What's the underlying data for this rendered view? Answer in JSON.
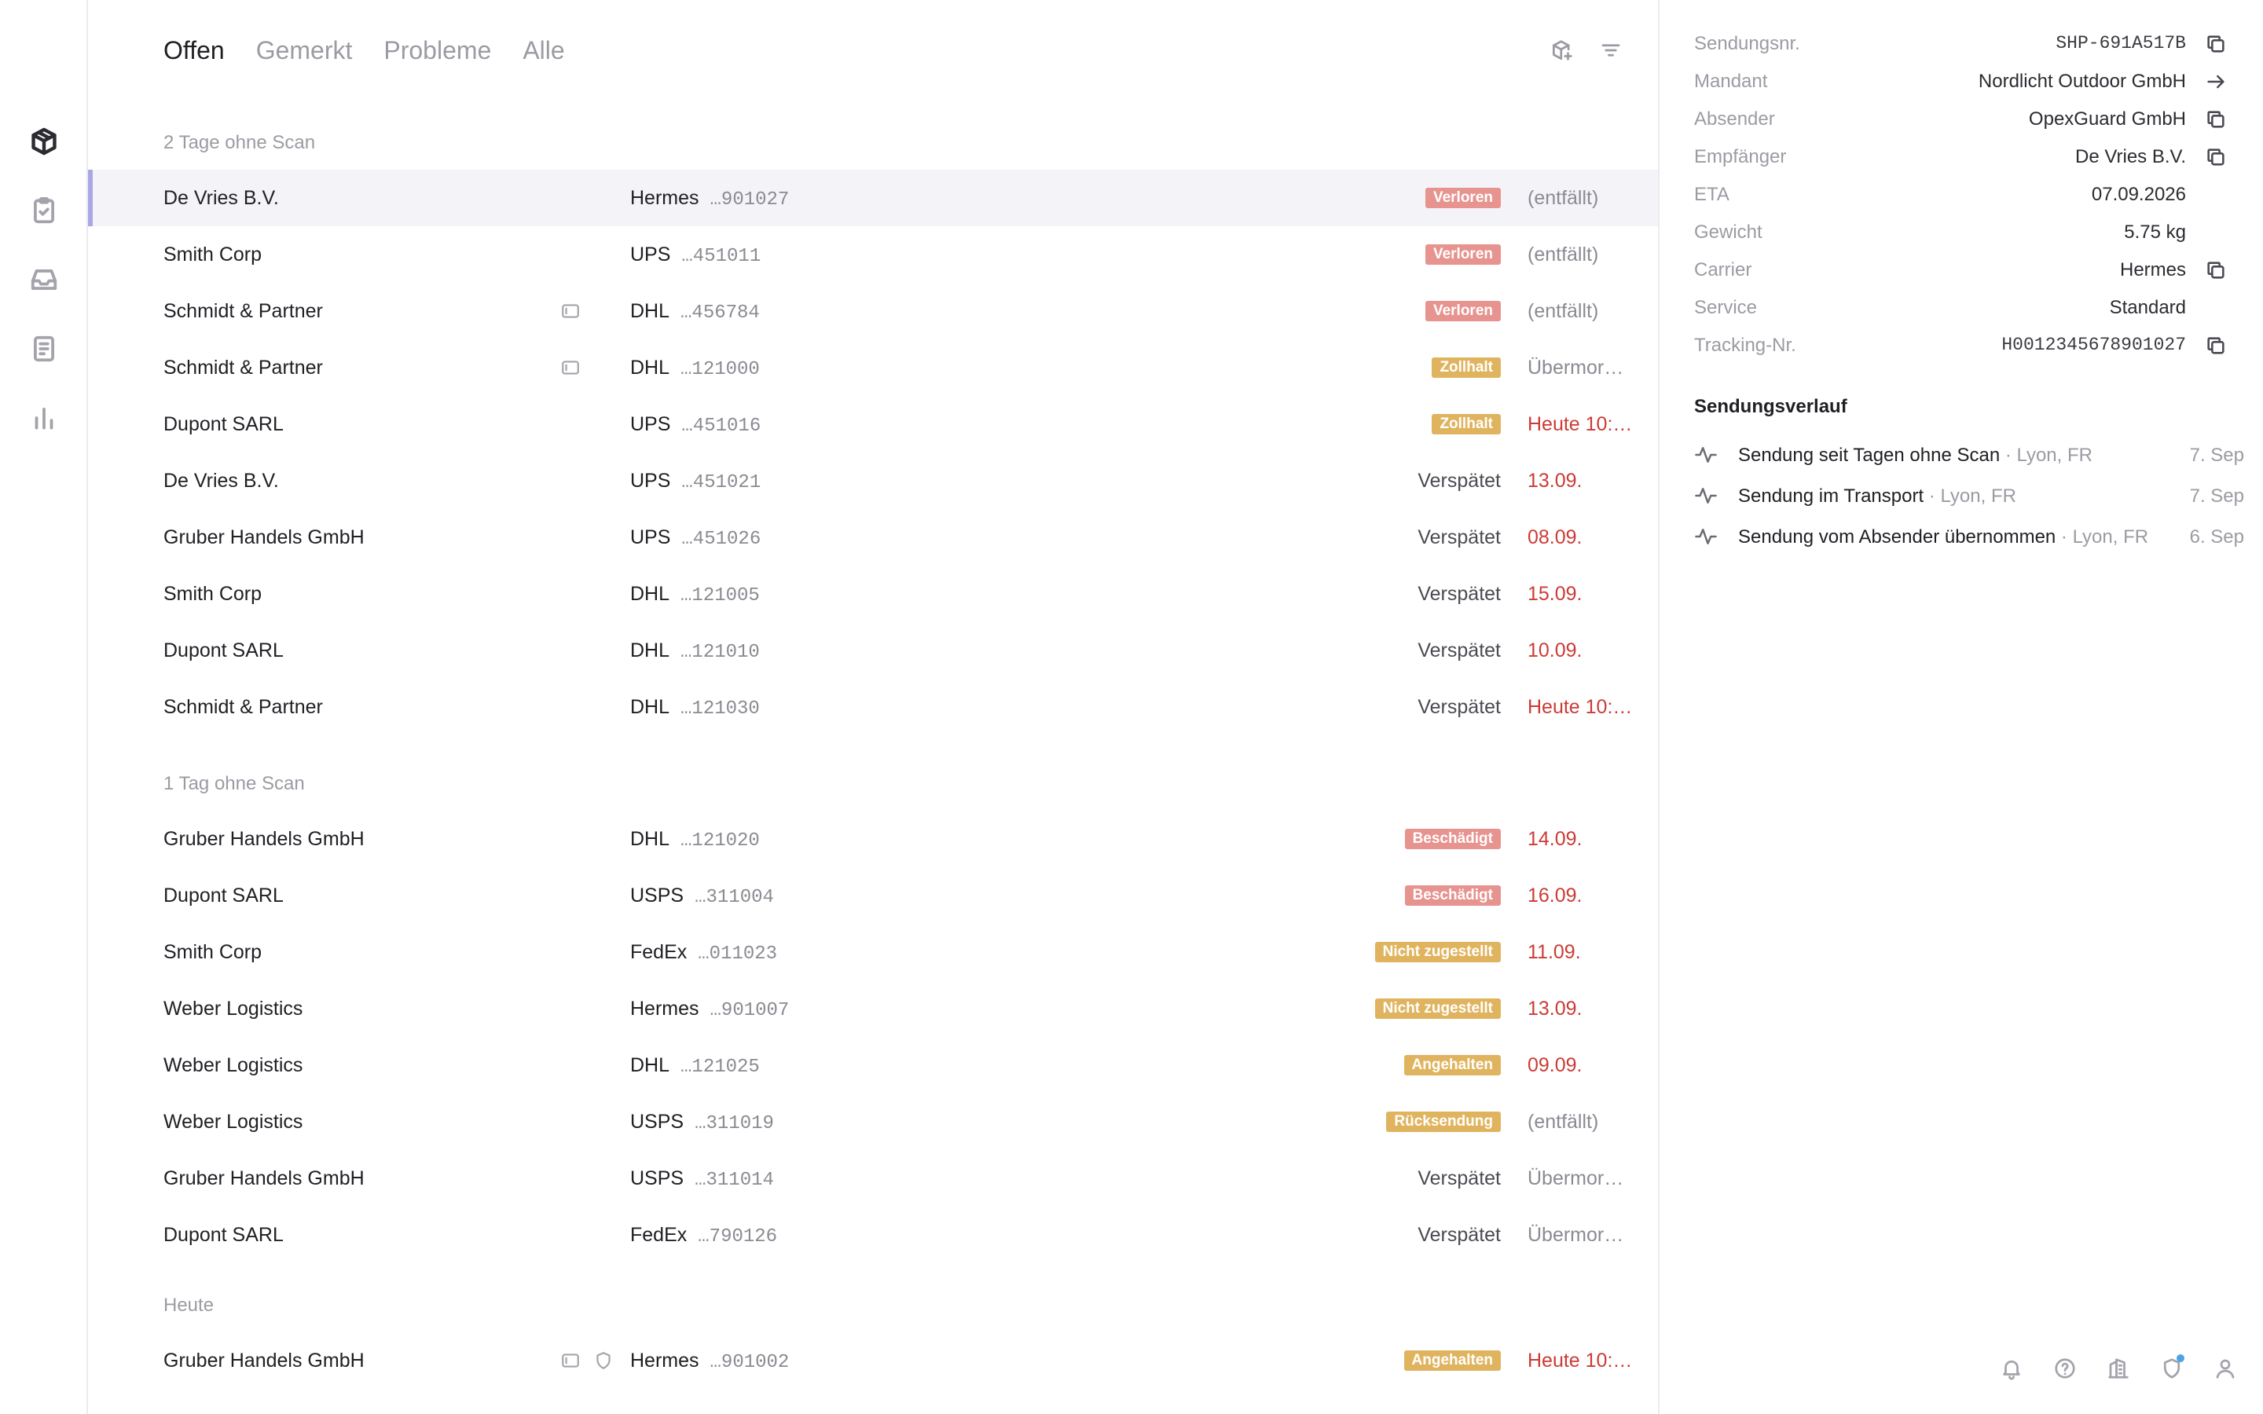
{
  "tabs": [
    {
      "label": "Offen",
      "active": true
    },
    {
      "label": "Gemerkt",
      "active": false
    },
    {
      "label": "Probleme",
      "active": false
    },
    {
      "label": "Alle",
      "active": false
    }
  ],
  "groups": [
    {
      "header": "2 Tage ohne Scan",
      "rows": [
        {
          "name": "De Vries B.V.",
          "carrier": "Hermes",
          "tracking": "…901027",
          "status": "Verloren",
          "status_kind": "badge-red",
          "date": "(entfällt)",
          "date_kind": "muted",
          "selected": true,
          "icons": []
        },
        {
          "name": "Smith Corp",
          "carrier": "UPS",
          "tracking": "…451011",
          "status": "Verloren",
          "status_kind": "badge-red",
          "date": "(entfällt)",
          "date_kind": "muted",
          "icons": []
        },
        {
          "name": "Schmidt & Partner",
          "carrier": "DHL",
          "tracking": "…456784",
          "status": "Verloren",
          "status_kind": "badge-red",
          "date": "(entfällt)",
          "date_kind": "muted",
          "icons": [
            "card-icon"
          ]
        },
        {
          "name": "Schmidt & Partner",
          "carrier": "DHL",
          "tracking": "…121000",
          "status": "Zollhalt",
          "status_kind": "badge-amber",
          "date": "Übermor…",
          "date_kind": "muted",
          "icons": [
            "card-icon"
          ]
        },
        {
          "name": "Dupont SARL",
          "carrier": "UPS",
          "tracking": "…451016",
          "status": "Zollhalt",
          "status_kind": "badge-amber",
          "date": "Heute 10:…",
          "date_kind": "red",
          "icons": []
        },
        {
          "name": "De Vries B.V.",
          "carrier": "UPS",
          "tracking": "…451021",
          "status": "Verspätet",
          "status_kind": "text",
          "date": "13.09.",
          "date_kind": "red",
          "icons": []
        },
        {
          "name": "Gruber Handels GmbH",
          "carrier": "UPS",
          "tracking": "…451026",
          "status": "Verspätet",
          "status_kind": "text",
          "date": "08.09.",
          "date_kind": "red",
          "icons": []
        },
        {
          "name": "Smith Corp",
          "carrier": "DHL",
          "tracking": "…121005",
          "status": "Verspätet",
          "status_kind": "text",
          "date": "15.09.",
          "date_kind": "red",
          "icons": []
        },
        {
          "name": "Dupont SARL",
          "carrier": "DHL",
          "tracking": "…121010",
          "status": "Verspätet",
          "status_kind": "text",
          "date": "10.09.",
          "date_kind": "red",
          "icons": []
        },
        {
          "name": "Schmidt & Partner",
          "carrier": "DHL",
          "tracking": "…121030",
          "status": "Verspätet",
          "status_kind": "text",
          "date": "Heute 10:…",
          "date_kind": "red",
          "icons": []
        }
      ]
    },
    {
      "header": "1 Tag ohne Scan",
      "rows": [
        {
          "name": "Gruber Handels GmbH",
          "carrier": "DHL",
          "tracking": "…121020",
          "status": "Beschädigt",
          "status_kind": "badge-red",
          "date": "14.09.",
          "date_kind": "red",
          "icons": []
        },
        {
          "name": "Dupont SARL",
          "carrier": "USPS",
          "tracking": "…311004",
          "status": "Beschädigt",
          "status_kind": "badge-red",
          "date": "16.09.",
          "date_kind": "red",
          "icons": []
        },
        {
          "name": "Smith Corp",
          "carrier": "FedEx",
          "tracking": "…011023",
          "status": "Nicht zugestellt",
          "status_kind": "badge-amber",
          "date": "11.09.",
          "date_kind": "red",
          "icons": []
        },
        {
          "name": "Weber Logistics",
          "carrier": "Hermes",
          "tracking": "…901007",
          "status": "Nicht zugestellt",
          "status_kind": "badge-amber",
          "date": "13.09.",
          "date_kind": "red",
          "icons": []
        },
        {
          "name": "Weber Logistics",
          "carrier": "DHL",
          "tracking": "…121025",
          "status": "Angehalten",
          "status_kind": "badge-amber",
          "date": "09.09.",
          "date_kind": "red",
          "icons": []
        },
        {
          "name": "Weber Logistics",
          "carrier": "USPS",
          "tracking": "…311019",
          "status": "Rücksendung",
          "status_kind": "badge-amber",
          "date": "(entfällt)",
          "date_kind": "muted",
          "icons": []
        },
        {
          "name": "Gruber Handels GmbH",
          "carrier": "USPS",
          "tracking": "…311014",
          "status": "Verspätet",
          "status_kind": "text",
          "date": "Übermor…",
          "date_kind": "muted",
          "icons": []
        },
        {
          "name": "Dupont SARL",
          "carrier": "FedEx",
          "tracking": "…790126",
          "status": "Verspätet",
          "status_kind": "text",
          "date": "Übermor…",
          "date_kind": "muted",
          "icons": []
        }
      ]
    },
    {
      "header": "Heute",
      "rows": [
        {
          "name": "Gruber Handels GmbH",
          "carrier": "Hermes",
          "tracking": "…901002",
          "status": "Angehalten",
          "status_kind": "badge-amber",
          "date": "Heute 10:…",
          "date_kind": "red",
          "icons": [
            "card-icon",
            "shield-icon"
          ]
        }
      ]
    }
  ],
  "detail": {
    "fields": [
      {
        "label": "Sendungsnr.",
        "value": "SHP-691A517B",
        "mono": true,
        "action": "copy-icon"
      },
      {
        "label": "Mandant",
        "value": "Nordlicht Outdoor GmbH",
        "mono": false,
        "action": "arrow-right-icon"
      },
      {
        "label": "Absender",
        "value": "OpexGuard GmbH",
        "mono": false,
        "action": "copy-icon"
      },
      {
        "label": "Empfänger",
        "value": "De Vries B.V.",
        "mono": false,
        "action": "copy-icon"
      },
      {
        "label": "ETA",
        "value": "07.09.2026",
        "mono": false,
        "action": ""
      },
      {
        "label": "Gewicht",
        "value": "5.75 kg",
        "mono": false,
        "action": ""
      },
      {
        "label": "Carrier",
        "value": "Hermes",
        "mono": false,
        "action": "copy-icon"
      },
      {
        "label": "Service",
        "value": "Standard",
        "mono": false,
        "action": ""
      },
      {
        "label": "Tracking-Nr.",
        "value": "H0012345678901027",
        "mono": true,
        "action": "copy-icon"
      }
    ],
    "history_title": "Sendungsverlauf",
    "history": [
      {
        "text": "Sendung seit Tagen ohne Scan",
        "location": " · Lyon, FR",
        "date": "7. Sep"
      },
      {
        "text": "Sendung im Transport",
        "location": " · Lyon, FR",
        "date": "7. Sep"
      },
      {
        "text": "Sendung vom Absender übernommen",
        "location": " · Lyon, FR",
        "date": "6. Sep"
      }
    ]
  },
  "rail_icons": [
    "package-icon",
    "clipboard-check-icon",
    "inbox-icon",
    "document-icon",
    "bar-chart-icon"
  ],
  "toolbar_icons": [
    "package-add-icon",
    "filter-icon"
  ],
  "bottom_icons": [
    "bell-icon",
    "help-icon",
    "building-icon",
    "shield-notification-icon",
    "user-icon"
  ],
  "colors": {
    "accent": "#a9a6e6",
    "badge_red": "#e7938f",
    "badge_amber": "#e0b45f",
    "date_red": "#cc3b35"
  }
}
